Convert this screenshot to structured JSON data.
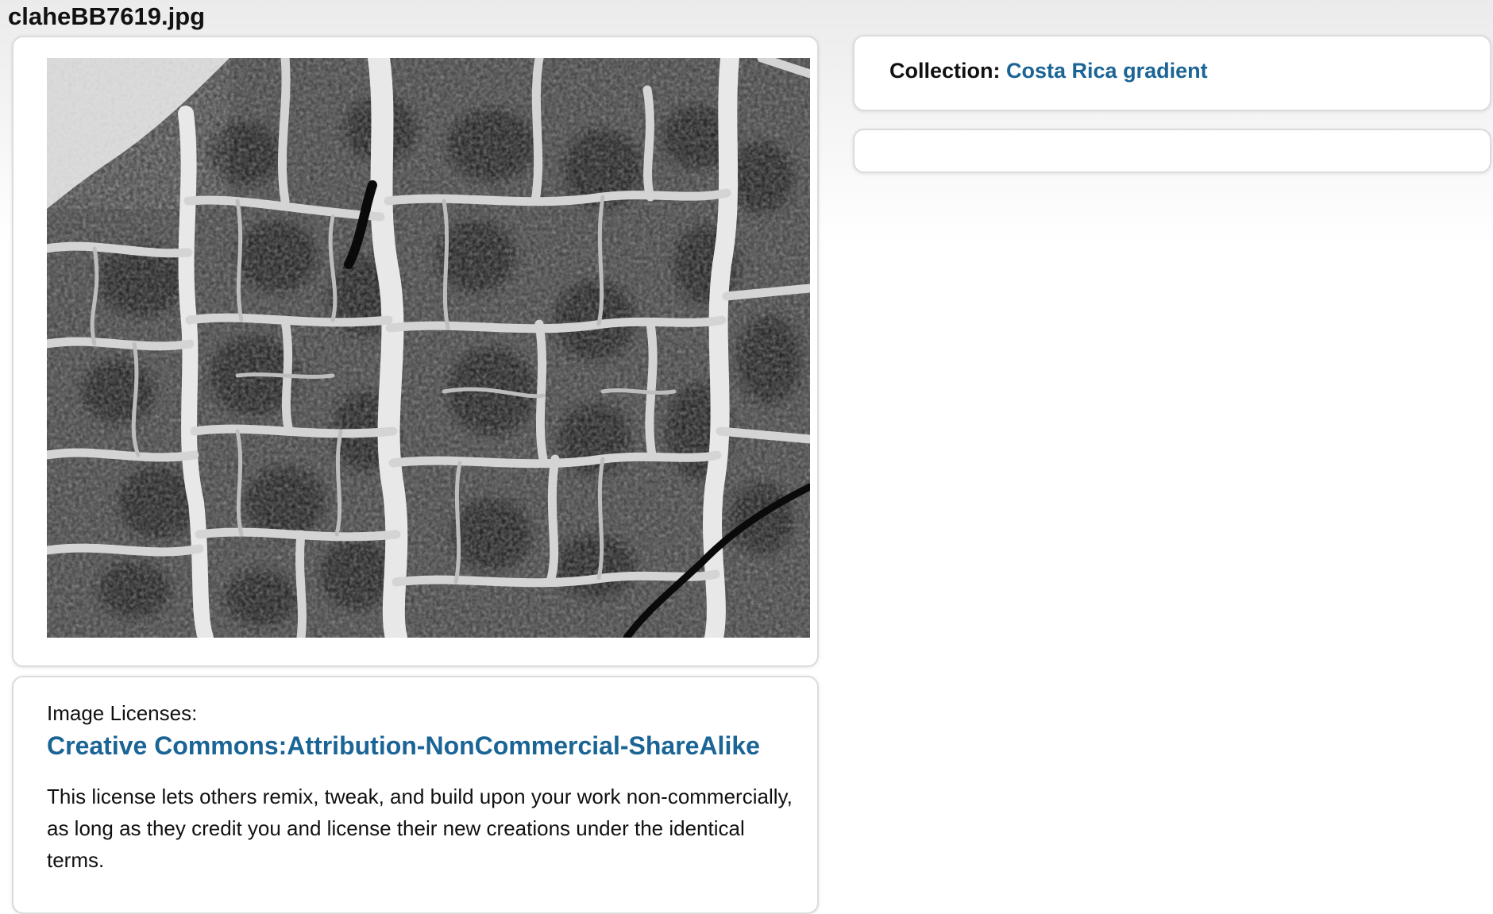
{
  "page": {
    "file_title": "claheBB7619.jpg"
  },
  "image": {
    "alt": "claheBB7619.jpg"
  },
  "license": {
    "heading": "Image Licenses:",
    "link_text": "Creative Commons:Attribution-NonCommercial-ShareAlike",
    "description": "This license lets others remix, tweak, and build upon your work non-commercially, as long as they credit you and license their new creations under the identical terms."
  },
  "collection": {
    "label": "Collection:",
    "value": "Costa Rica gradient"
  },
  "colors": {
    "link": "#1a6496",
    "text": "#111111",
    "card_border": "#dcdcdc"
  }
}
